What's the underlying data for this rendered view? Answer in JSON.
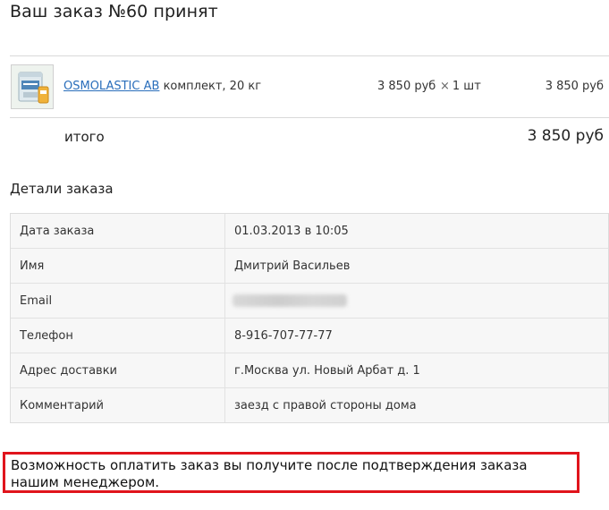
{
  "order": {
    "title": "Ваш заказ №60 принят"
  },
  "item": {
    "name": "OSMOLASTIC AB",
    "description": "комплект, 20 кг",
    "unit_price": "3 850 руб",
    "quantity_symbol": "×",
    "quantity": "1 шт",
    "line_total": "3 850 руб",
    "thumbnail_icon": "product-bucket-image"
  },
  "totals": {
    "label": "итого",
    "value": "3 850 руб"
  },
  "details": {
    "title": "Детали заказа",
    "rows": [
      {
        "label": "Дата заказа",
        "value": "01.03.2013 в 10:05"
      },
      {
        "label": "Имя",
        "value": "Дмитрий Васильев"
      },
      {
        "label": "Email",
        "value": ""
      },
      {
        "label": "Телефон",
        "value": "8-916-707-77-77"
      },
      {
        "label": "Адрес доставки",
        "value": "г.Москва ул. Новый Арбат д. 1"
      },
      {
        "label": "Комментарий",
        "value": "заезд с правой стороны дома"
      }
    ]
  },
  "notice": {
    "text": "Возможность оплатить заказ вы получите после подтверждения заказа нашим менеджером."
  },
  "colors": {
    "link": "#2a6ebb",
    "notice_border": "#e0141c",
    "table_bg": "#f7f7f7"
  }
}
